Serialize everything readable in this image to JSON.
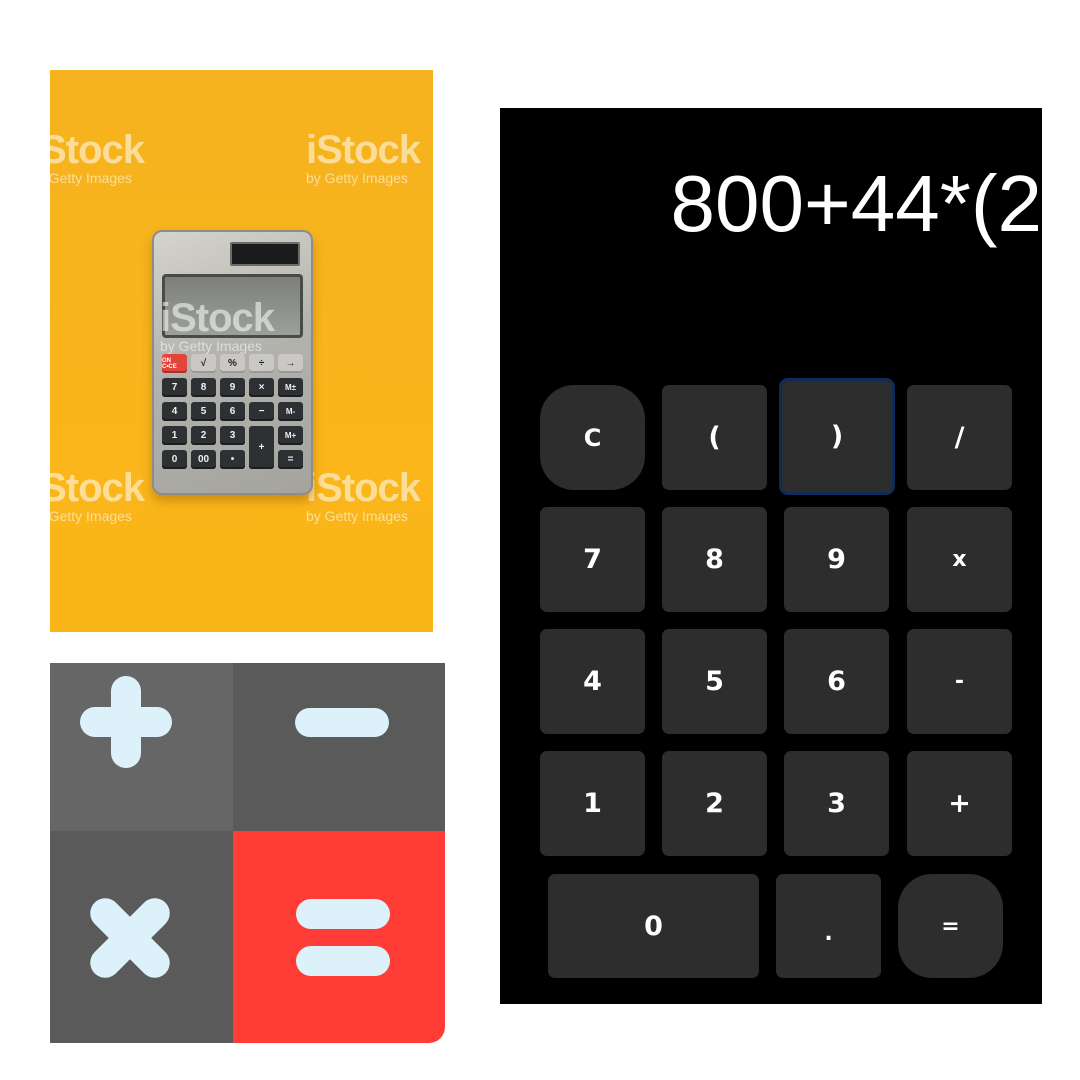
{
  "photo_panel": {
    "watermarks": [
      {
        "brand": "iStock",
        "credit": "by Getty Images"
      },
      {
        "brand": "iStock",
        "credit": "by Getty Images"
      },
      {
        "brand": "iStock",
        "credit": "by Getty Images"
      },
      {
        "brand": "iStock",
        "credit": "by Getty Images"
      },
      {
        "brand": "iStock",
        "credit": "by Getty Images"
      }
    ],
    "calculator_keys": [
      "ON C•CE",
      "√",
      "%",
      "÷",
      "→",
      "7",
      "8",
      "9",
      "×",
      "M±",
      "4",
      "5",
      "6",
      "−",
      "M-",
      "1",
      "2",
      "3",
      "+",
      "M+",
      "0",
      "00",
      "•",
      "=",
      ""
    ],
    "background_color": "#f9b51b"
  },
  "icon_panel": {
    "symbols": [
      "plus-icon",
      "minus-icon",
      "multiply-icon",
      "equals-icon"
    ],
    "colors": {
      "gray_light": "#666666",
      "gray_dark": "#5a5a5a",
      "red": "#ff3c36",
      "symbol": "#dcf1fa"
    }
  },
  "calculator": {
    "display": "800+44*(2",
    "keys": {
      "clear": "C",
      "open_paren": "(",
      "close_paren": ")",
      "divide": "/",
      "seven": "7",
      "eight": "8",
      "nine": "9",
      "multiply": "x",
      "four": "4",
      "five": "5",
      "six": "6",
      "minus": "-",
      "one": "1",
      "two": "2",
      "three": "3",
      "plus": "+",
      "zero": "0",
      "decimal": ".",
      "equals": "="
    },
    "colors": {
      "background": "#000000",
      "key": "#2d2d2d",
      "focus_ring": "#0e2c56",
      "text": "#ffffff"
    }
  }
}
